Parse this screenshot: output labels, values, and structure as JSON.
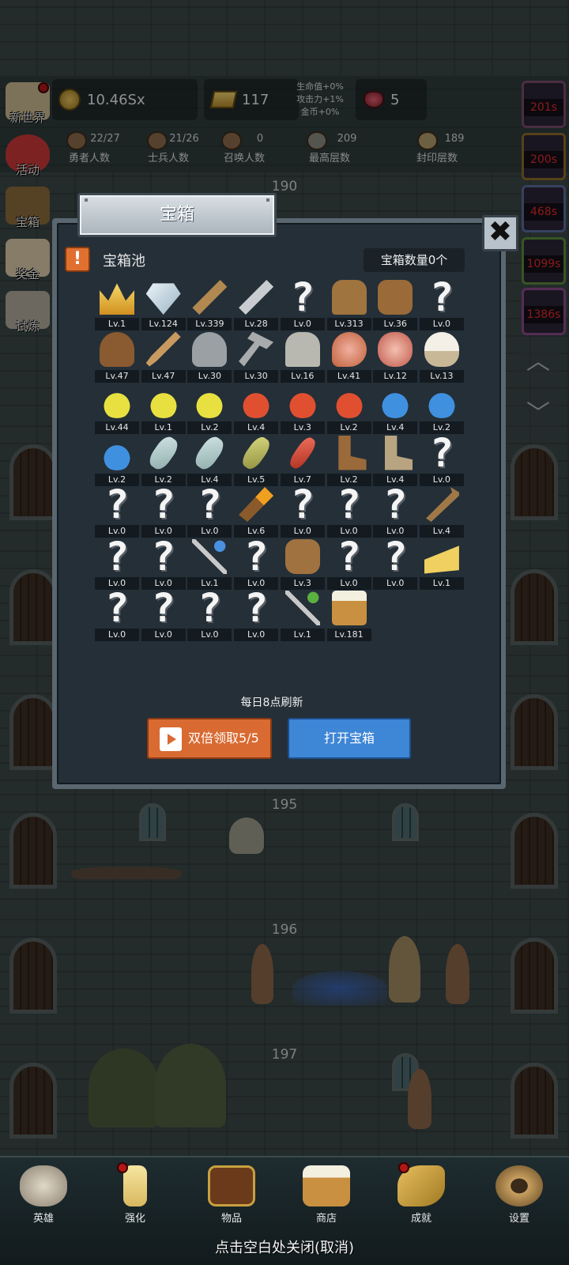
{
  "hud": {
    "coins": "10.46Sx",
    "gold": "117",
    "gems": "5",
    "bonus": [
      "生命值+0%",
      "攻击力+1%",
      "金币+0%"
    ]
  },
  "stats": [
    {
      "value": "22/27",
      "label": "勇者人数"
    },
    {
      "value": "21/26",
      "label": "士兵人数"
    },
    {
      "value": "0",
      "label": "召唤人数"
    },
    {
      "value": "209",
      "label": "最高层数"
    },
    {
      "value": "189",
      "label": "封印层数"
    }
  ],
  "side_menu": [
    "新世界",
    "活动",
    "宝箱",
    "奖金",
    "试炼"
  ],
  "timers": [
    "201s",
    "200s",
    "468s",
    "1099s",
    "1386s"
  ],
  "floors": [
    "190",
    "195",
    "196",
    "197"
  ],
  "dialog": {
    "title": "宝箱",
    "pool_title": "宝箱池",
    "warn": "!",
    "chest_count": "宝箱数量0个",
    "close": "✖",
    "refresh_note": "每日8点刷新",
    "double_label": "双倍领取5/5",
    "open_label": "打开宝箱"
  },
  "items": [
    {
      "icon": "crown-icon",
      "lv": "Lv.1"
    },
    {
      "icon": "diamond-icon",
      "lv": "Lv.124"
    },
    {
      "icon": "wooden-sword-icon",
      "lv": "Lv.339"
    },
    {
      "icon": "iron-sword-icon",
      "lv": "Lv.28"
    },
    {
      "icon": "unknown-icon",
      "lv": "Lv.0"
    },
    {
      "icon": "leather-armor-icon",
      "lv": "Lv.313"
    },
    {
      "icon": "backpack-armor-icon",
      "lv": "Lv.36"
    },
    {
      "icon": "unknown-icon",
      "lv": "Lv.0"
    },
    {
      "icon": "leather-hood-icon",
      "lv": "Lv.47"
    },
    {
      "icon": "dagger-icon",
      "lv": "Lv.47"
    },
    {
      "icon": "iron-helmet-icon",
      "lv": "Lv.30"
    },
    {
      "icon": "hammer-icon",
      "lv": "Lv.30"
    },
    {
      "icon": "knight-helmet-icon",
      "lv": "Lv.16"
    },
    {
      "icon": "ham-icon",
      "lv": "Lv.41"
    },
    {
      "icon": "steak-icon",
      "lv": "Lv.12"
    },
    {
      "icon": "rice-bowl-icon",
      "lv": "Lv.13"
    },
    {
      "icon": "yellow-potion-icon",
      "lv": "Lv.44"
    },
    {
      "icon": "yellow-potion-icon",
      "lv": "Lv.1"
    },
    {
      "icon": "yellow-potion-icon",
      "lv": "Lv.2"
    },
    {
      "icon": "red-potion-icon",
      "lv": "Lv.4"
    },
    {
      "icon": "red-potion-icon",
      "lv": "Lv.3"
    },
    {
      "icon": "red-potion-icon",
      "lv": "Lv.2"
    },
    {
      "icon": "blue-potion-icon",
      "lv": "Lv.4"
    },
    {
      "icon": "blue-potion-icon",
      "lv": "Lv.2"
    },
    {
      "icon": "blue-potion-icon",
      "lv": "Lv.2"
    },
    {
      "icon": "glass-bottle-icon",
      "lv": "Lv.2"
    },
    {
      "icon": "glass-bottle-icon",
      "lv": "Lv.4"
    },
    {
      "icon": "olive-bottle-icon",
      "lv": "Lv.5"
    },
    {
      "icon": "red-vial-icon",
      "lv": "Lv.7"
    },
    {
      "icon": "leather-boot-icon",
      "lv": "Lv.2"
    },
    {
      "icon": "cloth-boot-icon",
      "lv": "Lv.4"
    },
    {
      "icon": "unknown-icon",
      "lv": "Lv.0"
    },
    {
      "icon": "unknown-icon",
      "lv": "Lv.0"
    },
    {
      "icon": "unknown-icon",
      "lv": "Lv.0"
    },
    {
      "icon": "unknown-icon",
      "lv": "Lv.0"
    },
    {
      "icon": "torch-icon",
      "lv": "Lv.6"
    },
    {
      "icon": "unknown-icon",
      "lv": "Lv.0"
    },
    {
      "icon": "unknown-icon",
      "lv": "Lv.0"
    },
    {
      "icon": "unknown-icon",
      "lv": "Lv.0"
    },
    {
      "icon": "wooden-staff-icon",
      "lv": "Lv.4"
    },
    {
      "icon": "unknown-icon",
      "lv": "Lv.0"
    },
    {
      "icon": "unknown-icon",
      "lv": "Lv.0"
    },
    {
      "icon": "blue-wand-icon",
      "lv": "Lv.1"
    },
    {
      "icon": "unknown-icon",
      "lv": "Lv.0"
    },
    {
      "icon": "travel-bag-icon",
      "lv": "Lv.3"
    },
    {
      "icon": "unknown-icon",
      "lv": "Lv.0"
    },
    {
      "icon": "unknown-icon",
      "lv": "Lv.0"
    },
    {
      "icon": "cheese-icon",
      "lv": "Lv.1"
    },
    {
      "icon": "unknown-icon",
      "lv": "Lv.0"
    },
    {
      "icon": "unknown-icon",
      "lv": "Lv.0"
    },
    {
      "icon": "unknown-icon",
      "lv": "Lv.0"
    },
    {
      "icon": "unknown-icon",
      "lv": "Lv.0"
    },
    {
      "icon": "green-wand-icon",
      "lv": "Lv.1"
    },
    {
      "icon": "beer-mug-icon",
      "lv": "Lv.181"
    }
  ],
  "nav": [
    {
      "icon": "skull-icon",
      "label": "英雄",
      "dot": false
    },
    {
      "icon": "candle-icon",
      "label": "强化",
      "dot": true
    },
    {
      "icon": "book-icon",
      "label": "物品",
      "dot": false
    },
    {
      "icon": "beer-icon",
      "label": "商店",
      "dot": false
    },
    {
      "icon": "key-icon",
      "label": "成就",
      "dot": true
    },
    {
      "icon": "gear-icon",
      "label": "设置",
      "dot": false
    }
  ],
  "close_hint": "点击空白处关闭(取消)"
}
